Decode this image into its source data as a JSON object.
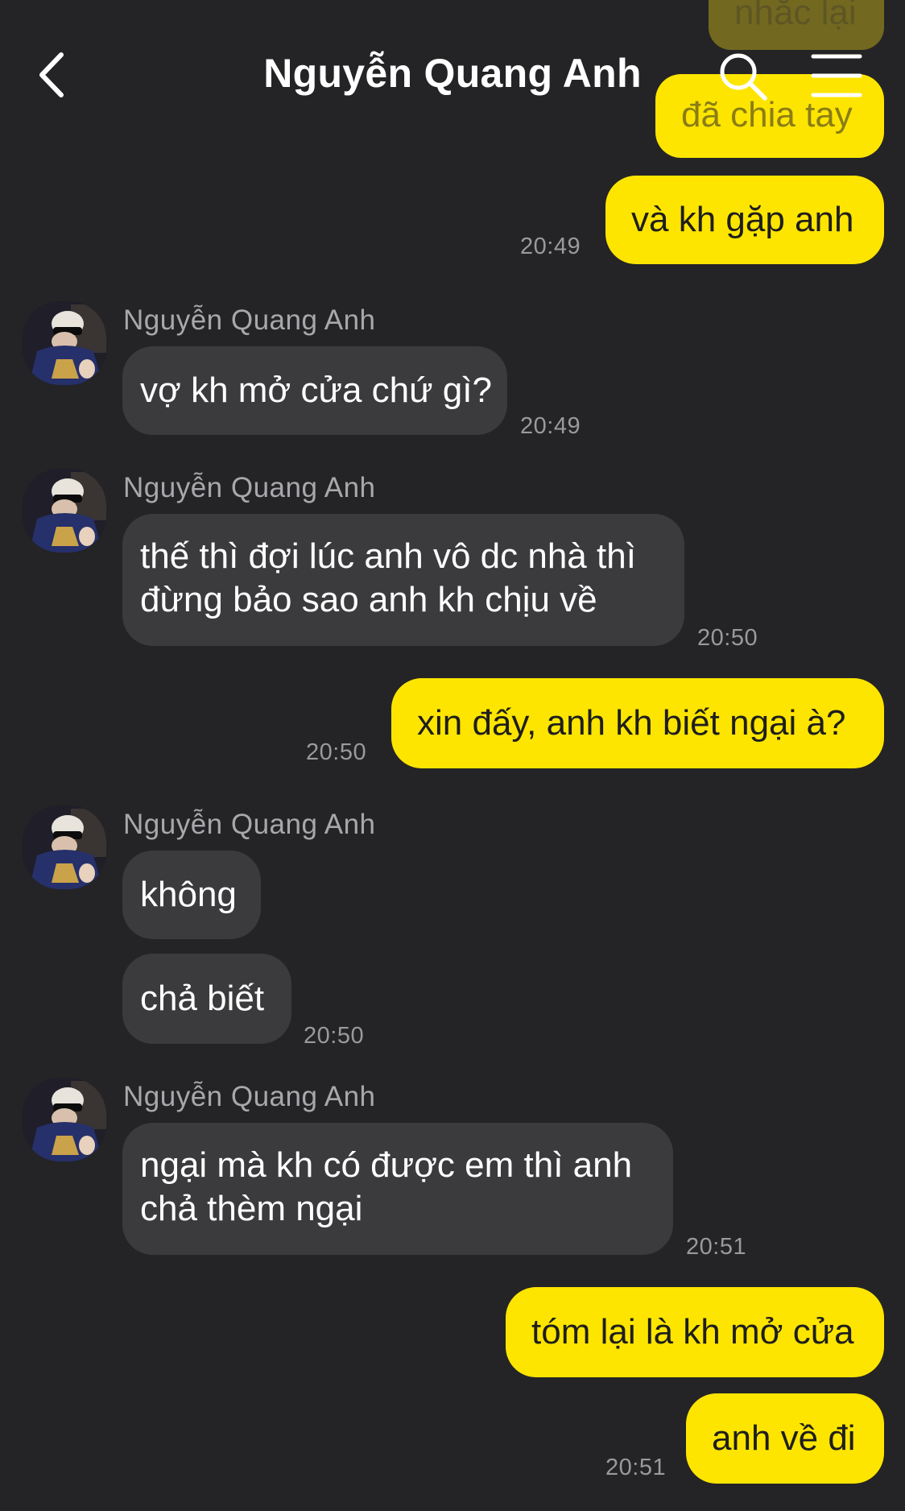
{
  "header": {
    "title": "Nguyễn Quang Anh"
  },
  "icons": {
    "back": "chevron-left-icon",
    "search": "search-icon",
    "menu": "hamburger-menu-icon"
  },
  "colors": {
    "background": "#242426",
    "outgoing_bubble": "#fee500",
    "incoming_bubble": "#3b3b3e",
    "timestamp": "#9a9a9e"
  },
  "messages": [
    {
      "dir": "out",
      "text": "nhắc lại"
    },
    {
      "dir": "out",
      "text": "đã chia tay"
    },
    {
      "dir": "out",
      "text": "và kh gặp anh",
      "time": "20:49"
    },
    {
      "dir": "in",
      "sender": "Nguyễn Quang Anh",
      "text": "vợ kh mở cửa chứ gì?",
      "time": "20:49"
    },
    {
      "dir": "in",
      "sender": "Nguyễn Quang Anh",
      "lines": [
        "thế thì đợi lúc anh vô dc nhà thì",
        "đừng bảo sao anh kh chịu về"
      ],
      "time": "20:50"
    },
    {
      "dir": "out",
      "text": "xin đấy, anh kh biết ngại à?",
      "time": "20:50"
    },
    {
      "dir": "in",
      "sender": "Nguyễn Quang Anh",
      "text": "không"
    },
    {
      "dir": "in",
      "text": "chả biết",
      "time": "20:50"
    },
    {
      "dir": "in",
      "sender": "Nguyễn Quang Anh",
      "lines": [
        "ngại mà kh có được em thì anh",
        "chả thèm ngại"
      ],
      "time": "20:51"
    },
    {
      "dir": "out",
      "text": "tóm lại là kh mở cửa"
    },
    {
      "dir": "out",
      "text": "anh về đi",
      "time": "20:51"
    }
  ]
}
